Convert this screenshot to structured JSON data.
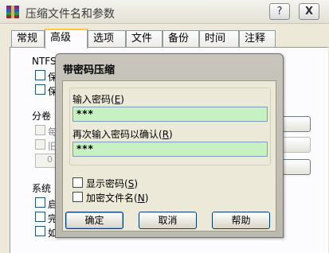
{
  "window": {
    "title": "压缩文件名和参数",
    "help_button": "?",
    "close_button": "X"
  },
  "tabs": [
    {
      "label": "常规"
    },
    {
      "label": "高级"
    },
    {
      "label": "选项"
    },
    {
      "label": "文件"
    },
    {
      "label": "备份"
    },
    {
      "label": "时间"
    },
    {
      "label": "注释"
    }
  ],
  "background": {
    "ntfs_label": "NTFS",
    "ntfs_item_1": "保",
    "ntfs_item_2": "保",
    "split_label": "分卷",
    "split_item_1": "每",
    "split_item_2": "旧",
    "split_value": "0",
    "system_label": "系统",
    "system_item_1": "启",
    "system_item_2": "完",
    "system_item_3": "如"
  },
  "dialog": {
    "title": "带密码压缩",
    "enter_password_label": "输入密码",
    "enter_password_key": "E",
    "enter_password_value": "***",
    "reenter_password_label": "再次输入密码以确认",
    "reenter_password_key": "R",
    "reenter_password_value": "***",
    "show_password_label": "显示密码",
    "show_password_key": "S",
    "show_password_checked": false,
    "encrypt_filenames_label": "加密文件名",
    "encrypt_filenames_key": "N",
    "encrypt_filenames_checked": false,
    "ok_button": "确定",
    "cancel_button": "取消",
    "help_button": "帮助"
  }
}
